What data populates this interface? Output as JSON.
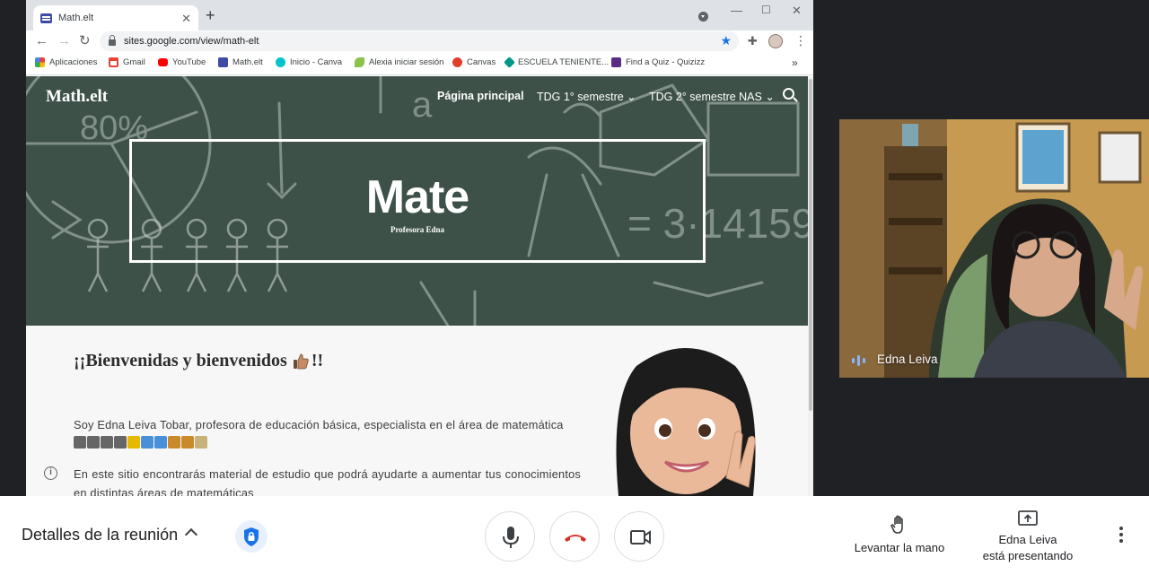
{
  "browser": {
    "tab_title": "Math.elt",
    "url": "sites.google.com/view/math-elt",
    "bookmarks": [
      {
        "label": "Aplicaciones",
        "color": "#4285f4"
      },
      {
        "label": "Gmail",
        "color": "#ea4335"
      },
      {
        "label": "YouTube",
        "color": "#ff0000"
      },
      {
        "label": "Math.elt",
        "color": "#3c4ba6"
      },
      {
        "label": "Inicio - Canva",
        "color": "#00c4cc"
      },
      {
        "label": "Alexia iniciar sesión",
        "color": "#8bc34a"
      },
      {
        "label": "Canvas",
        "color": "#e13f2b"
      },
      {
        "label": "ESCUELA TENIENTE...",
        "color": "#009688"
      },
      {
        "label": "Find a Quiz - Quizizz",
        "color": "#5b2c83"
      }
    ],
    "bookmarks_more": "»"
  },
  "site": {
    "logo": "Math.elt",
    "nav": {
      "home": "Página principal",
      "tdg1": "TDG 1° semestre",
      "tdg2": "TDG 2° semestre NAS"
    },
    "hero": {
      "title": "Mate",
      "subtitle": "Profesora Edna"
    },
    "welcome_start": "¡¡Bienvenidas y bienvenidos",
    "welcome_end": "!!",
    "para1": "Soy Edna Leiva Tobar, profesora de educación básica, especialista en el área de matemática",
    "para2": "En este sitio encontrarás material de estudio que podrá ayudarte a aumentar tus conocimientos en distintas áreas de matemáticas",
    "emoji_colors": [
      "#555555",
      "#555555",
      "#555555",
      "#555555",
      "#e6b800",
      "#4a90d9",
      "#4a90d9",
      "#c98a2b",
      "#c98a2b",
      "#c9b27a"
    ]
  },
  "participant": {
    "name": "Edna Leiva"
  },
  "meet": {
    "details": "Detalles de la reunión",
    "raise_hand": "Levantar la mano",
    "presenting_name": "Edna Leiva",
    "presenting_text": "está presentando"
  },
  "colors": {
    "hangup": "#d93025",
    "star": "#1a73e8",
    "shield": "#1a73e8"
  }
}
